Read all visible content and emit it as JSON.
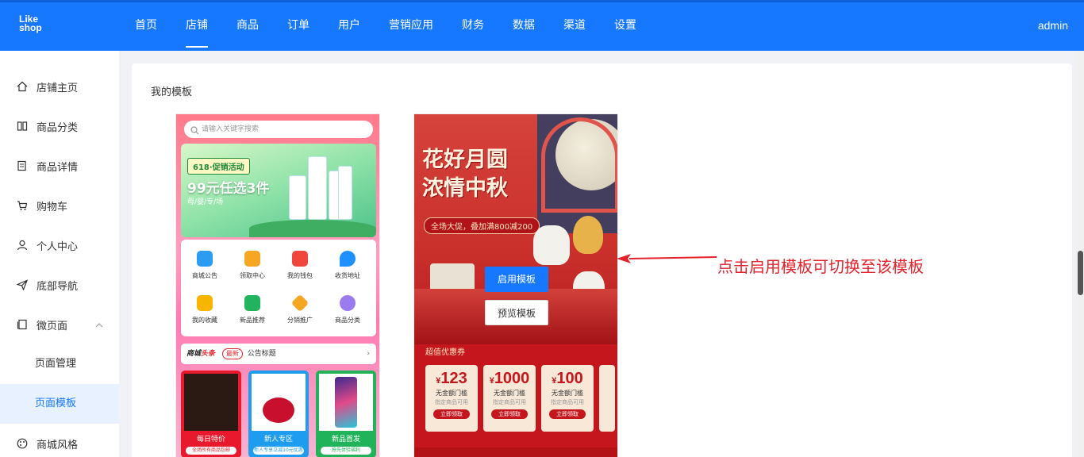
{
  "app": {
    "logo_line1": "Like",
    "logo_line2": "shop",
    "user": "admin"
  },
  "nav": [
    {
      "label": "首页"
    },
    {
      "label": "店铺"
    },
    {
      "label": "商品"
    },
    {
      "label": "订单"
    },
    {
      "label": "用户"
    },
    {
      "label": "营销应用"
    },
    {
      "label": "财务"
    },
    {
      "label": "数据"
    },
    {
      "label": "渠道"
    },
    {
      "label": "设置"
    }
  ],
  "nav_active": "店铺",
  "sidebar": {
    "items": [
      {
        "label": "店铺主页",
        "icon": "home-icon"
      },
      {
        "label": "商品分类",
        "icon": "columns-icon"
      },
      {
        "label": "商品详情",
        "icon": "detail-icon"
      },
      {
        "label": "购物车",
        "icon": "cart-icon"
      },
      {
        "label": "个人中心",
        "icon": "user-icon"
      },
      {
        "label": "底部导航",
        "icon": "send-icon"
      },
      {
        "label": "微页面",
        "icon": "page-icon"
      }
    ],
    "sub_items": [
      {
        "label": "页面管理"
      },
      {
        "label": "页面模板"
      }
    ],
    "after": {
      "label": "商城风格",
      "icon": "palette-icon"
    }
  },
  "main": {
    "title": "我的模板",
    "template1": {
      "search_placeholder": "请输入关键字搜索",
      "banner_tag": "618·促销活动",
      "banner_main": "99元任选3件",
      "banner_sub": "母/婴/专/场",
      "icons": [
        {
          "label": "商城公告",
          "color": "#2b9cf2"
        },
        {
          "label": "领取中心",
          "color": "#f5a623"
        },
        {
          "label": "我的钱包",
          "color": "#f0463c"
        },
        {
          "label": "收货地址",
          "color": "#1e90ff"
        },
        {
          "label": "我的收藏",
          "color": "#f7b500"
        },
        {
          "label": "新品推荐",
          "color": "#22b35e"
        },
        {
          "label": "分销推广",
          "color": "#f5a623"
        },
        {
          "label": "商品分类",
          "color": "#9b7bf0"
        }
      ],
      "news_brand_a": "商城",
      "news_brand_b": "头条",
      "news_badge": "最新",
      "news_text": "公告标题",
      "products": [
        {
          "label": "每日特价",
          "pill": "全场所有商品包邮",
          "color": "#e8192c"
        },
        {
          "label": "新人专区",
          "pill": "新人专享立减10元优惠",
          "color": "#1e9df0"
        },
        {
          "label": "新品首发",
          "pill": "抢先体验福利",
          "color": "#21b35a"
        }
      ]
    },
    "template2": {
      "title_line1": "花好月圆",
      "title_line2": "浓情中秋",
      "promo": "全场大促，叠加满800减200",
      "use_button": "启用模板",
      "preview_button": "预览模板",
      "coupon_title": "超值优惠券",
      "coupons": [
        {
          "symbol": "¥",
          "amount": "123",
          "line1": "无金额门槛",
          "line2": "指定商品可用",
          "action": "立即领取"
        },
        {
          "symbol": "¥",
          "amount": "1000",
          "line1": "无金额门槛",
          "line2": "指定商品可用",
          "action": "立即领取"
        },
        {
          "symbol": "¥",
          "amount": "100",
          "line1": "无金额门槛",
          "line2": "指定商品可用",
          "action": "立即领取"
        }
      ]
    },
    "annotation": "点击启用模板可切换至该模板"
  },
  "colors": {
    "primary": "#1677ff",
    "annotation": "#e5232d",
    "active_bg": "#e8f1ff"
  }
}
